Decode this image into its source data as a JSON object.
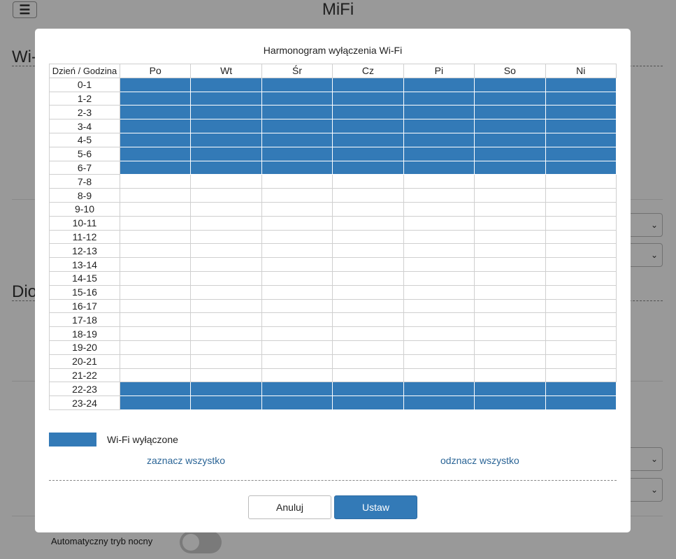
{
  "header": {
    "menu_icon": "hamburger-icon",
    "menu_glyph": "☰",
    "title": "MiFi"
  },
  "background": {
    "section1_heading": "Wi-",
    "section2_heading": "Dio",
    "night_mode_label": "Automatyczny tryb nocny",
    "night_mode_enabled": false
  },
  "modal": {
    "title": "Harmonogram wyłączenia Wi-Fi",
    "corner_header": "Dzień / Godzina",
    "days": [
      "Po",
      "Wt",
      "Śr",
      "Cz",
      "Pi",
      "So",
      "Ni"
    ],
    "hours": [
      "0-1",
      "1-2",
      "2-3",
      "3-4",
      "4-5",
      "5-6",
      "6-7",
      "7-8",
      "8-9",
      "9-10",
      "10-11",
      "11-12",
      "12-13",
      "13-14",
      "14-15",
      "15-16",
      "16-17",
      "17-18",
      "18-19",
      "19-20",
      "20-21",
      "21-22",
      "22-23",
      "23-24"
    ],
    "wifi_off_hours": [
      0,
      1,
      2,
      3,
      4,
      5,
      6,
      22,
      23
    ],
    "legend_label": "Wi-Fi wyłączone",
    "select_all": "zaznacz wszystko",
    "deselect_all": "odznacz wszystko",
    "cancel_label": "Anuluj",
    "set_label": "Ustaw"
  },
  "colors": {
    "accent": "#337ab7",
    "link": "#2a6496",
    "overlay": "rgba(0,0,0,0.4)"
  }
}
